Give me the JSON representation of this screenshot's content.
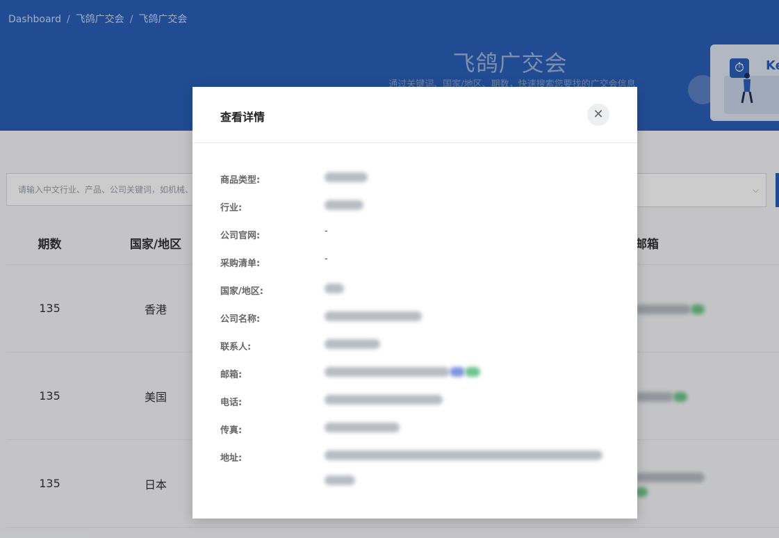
{
  "breadcrumb": {
    "items": [
      "Dashboard",
      "飞鸽广交会",
      "飞鸽广交会"
    ],
    "separator": "/"
  },
  "hero": {
    "title": "飞鸽广交会",
    "subtitle": "通过关键词、国家/地区、期数，快速搜索您要找的广交会信息",
    "card_text": "Ke"
  },
  "search": {
    "placeholder": "请输入中文行业、产品、公司关键词，如机械、"
  },
  "table": {
    "columns": [
      "期数",
      "国家/地区",
      "邮箱"
    ],
    "rows": [
      {
        "period": "135",
        "country": "香港"
      },
      {
        "period": "135",
        "country": "美国"
      },
      {
        "period": "135",
        "country": "日本"
      }
    ]
  },
  "modal": {
    "title": "查看详情",
    "close_icon": "close-icon",
    "fields": [
      {
        "label": "商品类型:",
        "value": ""
      },
      {
        "label": "行业:",
        "value": ""
      },
      {
        "label": "公司官网:",
        "value": "-"
      },
      {
        "label": "采购清单:",
        "value": "-"
      },
      {
        "label": "国家/地区:",
        "value": ""
      },
      {
        "label": "公司名称:",
        "value": ""
      },
      {
        "label": "联系人:",
        "value": ""
      },
      {
        "label": "邮箱:",
        "value": ""
      },
      {
        "label": "电话:",
        "value": ""
      },
      {
        "label": "传真:",
        "value": ""
      },
      {
        "label": "地址:",
        "value": ""
      }
    ]
  },
  "colors": {
    "header": "#2a5fb8",
    "mask": "rgba(0,0,0,0.2)"
  }
}
